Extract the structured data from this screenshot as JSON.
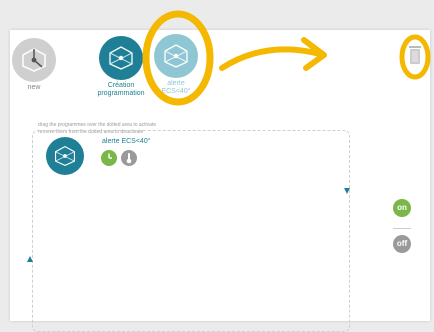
{
  "programs": [
    {
      "label": "new",
      "icon": "network-node-icon",
      "color": "#c8c8c8"
    },
    {
      "label": "Création programmation",
      "icon": "network-node-icon",
      "color": "#1e7f96"
    },
    {
      "label": "alerte ECS<40°",
      "icon": "network-node-icon",
      "color": "#8fc6d4"
    }
  ],
  "hint": {
    "line1": "drag the programmes over the dotted area to activate",
    "line2": "remove them from the dotted area to deactivate"
  },
  "active_program": {
    "title": "alerte ECS<40°",
    "icons": [
      "clock-icon",
      "thermometer-icon"
    ]
  },
  "toggle": {
    "on_label": "on",
    "off_label": "off"
  },
  "colors": {
    "accent": "#1e7f96",
    "on": "#7ab648",
    "off": "#9a9a9a",
    "highlight": "#f5b800"
  }
}
